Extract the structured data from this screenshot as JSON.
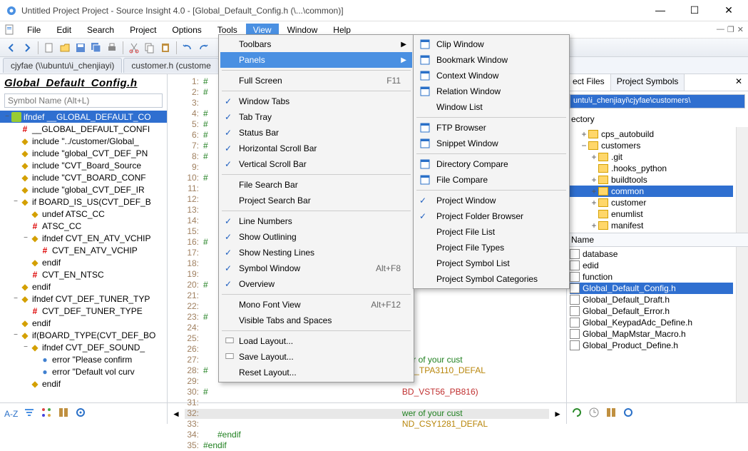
{
  "window": {
    "title": "Untitled Project Project - Source Insight 4.0 - [Global_Default_Config.h (\\...\\common)]"
  },
  "menubar": [
    "File",
    "Edit",
    "Search",
    "Project",
    "Options",
    "Tools",
    "View",
    "Window",
    "Help"
  ],
  "tabs": [
    {
      "label": "cjyfae (\\\\ubuntu\\i_chenjiayi)",
      "active": false
    },
    {
      "label": "customer.h (custome",
      "active": false
    }
  ],
  "left_panel": {
    "title": "Global_Default_Config.h",
    "symbol_placeholder": "Symbol Name (Alt+L)",
    "items": [
      {
        "d": 0,
        "tw": "−",
        "i": "g",
        "t": "ifndef __GLOBAL_DEFAULT_CO",
        "sel": true
      },
      {
        "d": 1,
        "tw": "",
        "i": "r",
        "t": "__GLOBAL_DEFAULT_CONFI"
      },
      {
        "d": 1,
        "tw": "",
        "i": "d",
        "t": "include \"../customer/Global_"
      },
      {
        "d": 1,
        "tw": "",
        "i": "d",
        "t": "include \"global_CVT_DEF_PN"
      },
      {
        "d": 1,
        "tw": "",
        "i": "d",
        "t": "include \"CVT_Board_Source"
      },
      {
        "d": 1,
        "tw": "",
        "i": "d",
        "t": "include \"CVT_BOARD_CONF"
      },
      {
        "d": 1,
        "tw": "",
        "i": "d",
        "t": "include \"global_CVT_DEF_IR"
      },
      {
        "d": 1,
        "tw": "−",
        "i": "d",
        "t": "if BOARD_IS_US(CVT_DEF_B"
      },
      {
        "d": 2,
        "tw": "",
        "i": "d",
        "t": "undef ATSC_CC"
      },
      {
        "d": 2,
        "tw": "",
        "i": "r",
        "t": "ATSC_CC"
      },
      {
        "d": 2,
        "tw": "−",
        "i": "d",
        "t": "ifndef CVT_EN_ATV_VCHIP"
      },
      {
        "d": 3,
        "tw": "",
        "i": "r",
        "t": "CVT_EN_ATV_VCHIP"
      },
      {
        "d": 2,
        "tw": "",
        "i": "d",
        "t": "endif"
      },
      {
        "d": 2,
        "tw": "",
        "i": "r",
        "t": "CVT_EN_NTSC"
      },
      {
        "d": 1,
        "tw": "",
        "i": "d",
        "t": "endif"
      },
      {
        "d": 1,
        "tw": "−",
        "i": "d",
        "t": "ifndef CVT_DEF_TUNER_TYP"
      },
      {
        "d": 2,
        "tw": "",
        "i": "r",
        "t": "CVT_DEF_TUNER_TYPE"
      },
      {
        "d": 1,
        "tw": "",
        "i": "d",
        "t": "endif"
      },
      {
        "d": 1,
        "tw": "−",
        "i": "d",
        "t": "if(BOARD_TYPE(CVT_DEF_BO"
      },
      {
        "d": 2,
        "tw": "−",
        "i": "d",
        "t": "ifndef CVT_DEF_SOUND_"
      },
      {
        "d": 3,
        "tw": "",
        "i": "b",
        "t": "error \"Please confirm "
      },
      {
        "d": 3,
        "tw": "",
        "i": "b",
        "t": "error \"Default vol curv"
      },
      {
        "d": 2,
        "tw": "",
        "i": "d",
        "t": "endif"
      }
    ]
  },
  "gutter_start": 1,
  "gutter_end": 35,
  "code_lines": [
    "#",
    "#",
    "",
    "#",
    "#",
    "#",
    "#",
    "#",
    "",
    "#",
    "",
    "",
    "",
    "",
    "",
    "#",
    "",
    "",
    "",
    "#",
    "",
    "",
    "#",
    "",
    "",
    "",
    "",
    "#",
    "",
    "#",
    "",
    "",
    "",
    "#endif",
    "#endif"
  ],
  "code_overlay": {
    "l27": "wer of your cust",
    "l28": "ND_TPA3110_DEFAL",
    "l30": "BD_VST56_PB816)",
    "l32": "wer of your cust",
    "l33": "ND_CSY1281_DEFAL"
  },
  "right_panel": {
    "tabs": [
      {
        "label": "ect Files",
        "active": true
      },
      {
        "label": "Project Symbols",
        "active": false
      }
    ],
    "path": "untu\\i_chenjiayi\\cjyfae\\customers\\",
    "dir_label": "ectory",
    "folders": [
      {
        "d": 1,
        "tw": "+",
        "t": "cps_autobuild"
      },
      {
        "d": 1,
        "tw": "−",
        "t": "customers"
      },
      {
        "d": 2,
        "tw": "+",
        "t": ".git"
      },
      {
        "d": 2,
        "tw": "",
        "t": ".hooks_python"
      },
      {
        "d": 2,
        "tw": "+",
        "t": "buildtools"
      },
      {
        "d": 2,
        "tw": "+",
        "t": "common",
        "sel": true
      },
      {
        "d": 2,
        "tw": "+",
        "t": "customer"
      },
      {
        "d": 2,
        "tw": "",
        "t": "enumlist"
      },
      {
        "d": 2,
        "tw": "+",
        "t": "manifest"
      }
    ],
    "filelist_hdr": "Name",
    "files": [
      "database",
      "edid",
      "function",
      {
        "t": "Global_Default_Config.h",
        "sel": true
      },
      "Global_Default_Draft.h",
      "Global_Default_Error.h",
      "Global_KeypadAdc_Define.h",
      "Global_MapMstar_Macro.h",
      "Global_Product_Define.h"
    ]
  },
  "view_menu": [
    {
      "t": "Toolbars",
      "arrow": true
    },
    {
      "t": "Panels",
      "arrow": true,
      "sel": true
    },
    {
      "sep": true
    },
    {
      "t": "Full Screen",
      "accel": "F11"
    },
    {
      "sep": true
    },
    {
      "t": "Window Tabs",
      "chk": true
    },
    {
      "t": "Tab Tray",
      "chk": true
    },
    {
      "t": "Status Bar",
      "chk": true
    },
    {
      "t": "Horizontal Scroll Bar",
      "chk": true
    },
    {
      "t": "Vertical Scroll Bar",
      "chk": true
    },
    {
      "sep": true
    },
    {
      "t": "File Search Bar"
    },
    {
      "t": "Project Search Bar"
    },
    {
      "sep": true
    },
    {
      "t": "Line Numbers",
      "chk": true
    },
    {
      "t": "Show Outlining",
      "chk": true
    },
    {
      "t": "Show Nesting Lines",
      "chk": true
    },
    {
      "t": "Symbol Window",
      "chk": true,
      "accel": "Alt+F8"
    },
    {
      "t": "Overview",
      "chk": true
    },
    {
      "sep": true
    },
    {
      "t": "Mono Font View",
      "accel": "Alt+F12"
    },
    {
      "t": "Visible Tabs and Spaces"
    },
    {
      "sep": true
    },
    {
      "t": "Load Layout...",
      "icon": true
    },
    {
      "t": "Save Layout...",
      "icon": true
    },
    {
      "t": "Reset Layout..."
    }
  ],
  "panels_submenu": [
    {
      "t": "Clip Window",
      "icon": "clip"
    },
    {
      "t": "Bookmark Window",
      "icon": "bm"
    },
    {
      "t": "Context Window",
      "icon": "ctx"
    },
    {
      "t": "Relation Window",
      "icon": "rel"
    },
    {
      "t": "Window List"
    },
    {
      "sep": true
    },
    {
      "t": "FTP Browser",
      "icon": "ftp"
    },
    {
      "t": "Snippet Window",
      "icon": "snip"
    },
    {
      "sep": true
    },
    {
      "t": "Directory Compare",
      "icon": "dc"
    },
    {
      "t": "File Compare",
      "icon": "fc"
    },
    {
      "sep": true
    },
    {
      "t": "Project Window",
      "chk": true
    },
    {
      "t": "Project Folder Browser",
      "chk": true
    },
    {
      "t": "Project File List"
    },
    {
      "t": "Project File Types"
    },
    {
      "t": "Project Symbol List"
    },
    {
      "t": "Project Symbol Categories"
    }
  ],
  "bottom": {
    "az": "A-Z"
  }
}
